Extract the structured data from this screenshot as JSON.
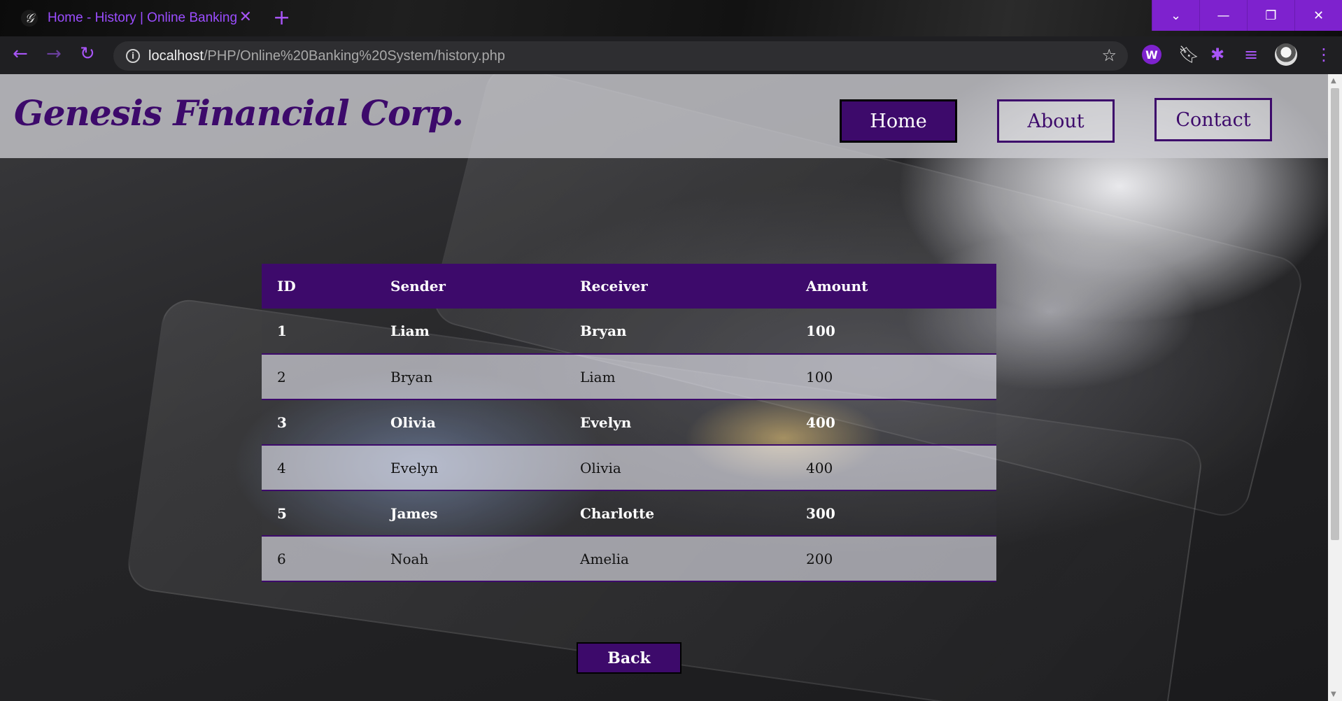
{
  "browser": {
    "tab_title": "Home - History | Online Banking",
    "url_host": "localhost",
    "url_path": "/PHP/Online%20Banking%20System/history.php"
  },
  "site": {
    "brand": "Genesis Financial Corp.",
    "nav": [
      {
        "label": "Home",
        "active": true
      },
      {
        "label": "About",
        "active": false
      },
      {
        "label": "Contact",
        "active": false
      }
    ]
  },
  "table": {
    "headers": [
      "ID",
      "Sender",
      "Receiver",
      "Amount"
    ],
    "rows": [
      {
        "id": "1",
        "sender": "Liam",
        "receiver": "Bryan",
        "amount": "100"
      },
      {
        "id": "2",
        "sender": "Bryan",
        "receiver": "Liam",
        "amount": "100"
      },
      {
        "id": "3",
        "sender": "Olivia",
        "receiver": "Evelyn",
        "amount": "400"
      },
      {
        "id": "4",
        "sender": "Evelyn",
        "receiver": "Olivia",
        "amount": "400"
      },
      {
        "id": "5",
        "sender": "James",
        "receiver": "Charlotte",
        "amount": "300"
      },
      {
        "id": "6",
        "sender": "Noah",
        "receiver": "Amelia",
        "amount": "200"
      }
    ]
  },
  "back_label": "Back",
  "colors": {
    "brand_purple": "#3d0a6b",
    "accent": "#a855f7"
  }
}
